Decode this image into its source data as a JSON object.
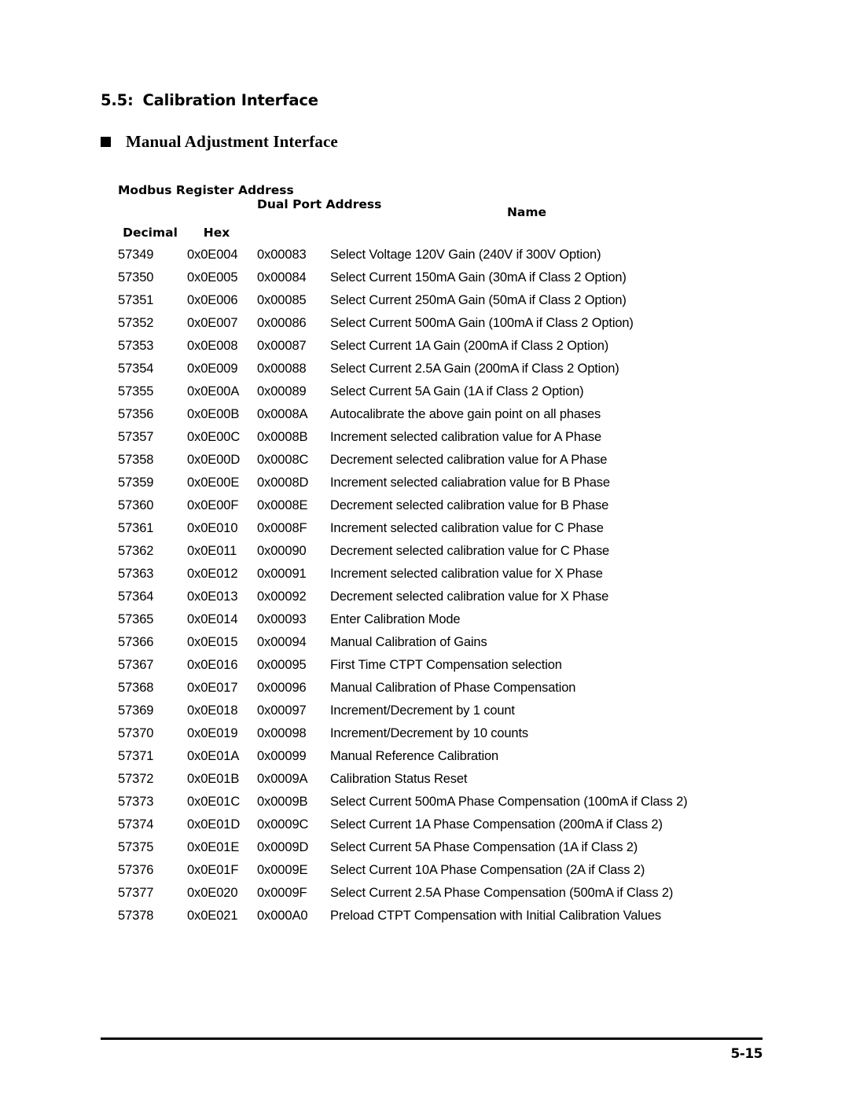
{
  "document": {
    "section_number": "5.5:",
    "section_title": "Calibration Interface",
    "subheading": "Manual Adjustment Interface",
    "page_number": "5-15"
  },
  "table": {
    "headers": {
      "group_modbus": "Modbus Register Address",
      "decimal": "Decimal",
      "hex": "Hex",
      "dual_port": "Dual Port Address",
      "name": "Name"
    },
    "rows": [
      {
        "decimal": "57349",
        "hex": "0x0E004",
        "dual": "0x00083",
        "name": "Select Voltage 120V Gain (240V if 300V Option)"
      },
      {
        "decimal": "57350",
        "hex": "0x0E005",
        "dual": "0x00084",
        "name": "Select Current 150mA Gain (30mA if Class 2 Option)"
      },
      {
        "decimal": "57351",
        "hex": "0x0E006",
        "dual": "0x00085",
        "name": "Select Current 250mA Gain (50mA if Class 2 Option)"
      },
      {
        "decimal": "57352",
        "hex": "0x0E007",
        "dual": "0x00086",
        "name": "Select Current 500mA Gain (100mA if Class 2 Option)"
      },
      {
        "decimal": "57353",
        "hex": "0x0E008",
        "dual": "0x00087",
        "name": "Select Current 1A Gain (200mA if Class 2 Option)"
      },
      {
        "decimal": "57354",
        "hex": "0x0E009",
        "dual": "0x00088",
        "name": "Select Current 2.5A Gain (200mA if Class 2 Option)"
      },
      {
        "decimal": "57355",
        "hex": "0x0E00A",
        "dual": "0x00089",
        "name": "Select Current 5A Gain (1A if Class 2 Option)"
      },
      {
        "decimal": "57356",
        "hex": "0x0E00B",
        "dual": "0x0008A",
        "name": "Autocalibrate the above gain point on all phases"
      },
      {
        "decimal": "57357",
        "hex": "0x0E00C",
        "dual": "0x0008B",
        "name": "Increment selected calibration value for A Phase"
      },
      {
        "decimal": "57358",
        "hex": "0x0E00D",
        "dual": "0x0008C",
        "name": "Decrement selected calibration value for A Phase"
      },
      {
        "decimal": "57359",
        "hex": "0x0E00E",
        "dual": "0x0008D",
        "name": "Increment selected caliabration value for B Phase"
      },
      {
        "decimal": "57360",
        "hex": "0x0E00F",
        "dual": "0x0008E",
        "name": "Decrement selected calibration value for B Phase"
      },
      {
        "decimal": "57361",
        "hex": "0x0E010",
        "dual": "0x0008F",
        "name": "Increment selected calibration value for C Phase"
      },
      {
        "decimal": "57362",
        "hex": "0x0E011",
        "dual": "0x00090",
        "name": "Decrement selected calibration value for C Phase"
      },
      {
        "decimal": "57363",
        "hex": "0x0E012",
        "dual": "0x00091",
        "name": "Increment selected calibration value for X Phase"
      },
      {
        "decimal": "57364",
        "hex": "0x0E013",
        "dual": "0x00092",
        "name": "Decrement selected calibration value for X Phase"
      },
      {
        "decimal": "57365",
        "hex": "0x0E014",
        "dual": "0x00093",
        "name": "Enter Calibration Mode"
      },
      {
        "decimal": "57366",
        "hex": "0x0E015",
        "dual": "0x00094",
        "name": "Manual Calibration of Gains"
      },
      {
        "decimal": "57367",
        "hex": "0x0E016",
        "dual": "0x00095",
        "name": "First Time CTPT Compensation selection"
      },
      {
        "decimal": "57368",
        "hex": "0x0E017",
        "dual": "0x00096",
        "name": "Manual Calibration of Phase Compensation"
      },
      {
        "decimal": "57369",
        "hex": "0x0E018",
        "dual": "0x00097",
        "name": "Increment/Decrement by 1 count"
      },
      {
        "decimal": "57370",
        "hex": "0x0E019",
        "dual": "0x00098",
        "name": "Increment/Decrement by 10 counts"
      },
      {
        "decimal": "57371",
        "hex": "0x0E01A",
        "dual": "0x00099",
        "name": "Manual Reference Calibration"
      },
      {
        "decimal": "57372",
        "hex": "0x0E01B",
        "dual": "0x0009A",
        "name": "Calibration Status Reset"
      },
      {
        "decimal": "57373",
        "hex": "0x0E01C",
        "dual": "0x0009B",
        "name": "Select Current 500mA Phase Compensation (100mA if Class 2)"
      },
      {
        "decimal": "57374",
        "hex": "0x0E01D",
        "dual": "0x0009C",
        "name": "Select Current 1A Phase Compensation (200mA if Class 2)"
      },
      {
        "decimal": "57375",
        "hex": "0x0E01E",
        "dual": "0x0009D",
        "name": "Select Current 5A Phase Compensation (1A if Class 2)"
      },
      {
        "decimal": "57376",
        "hex": "0x0E01F",
        "dual": "0x0009E",
        "name": "Select Current 10A Phase Compensation (2A if Class 2)"
      },
      {
        "decimal": "57377",
        "hex": "0x0E020",
        "dual": "0x0009F",
        "name": "Select Current 2.5A Phase Compensation (500mA if Class 2)"
      },
      {
        "decimal": "57378",
        "hex": "0x0E021",
        "dual": "0x000A0",
        "name": "Preload CTPT Compensation with Initial Calibration Values"
      }
    ]
  }
}
